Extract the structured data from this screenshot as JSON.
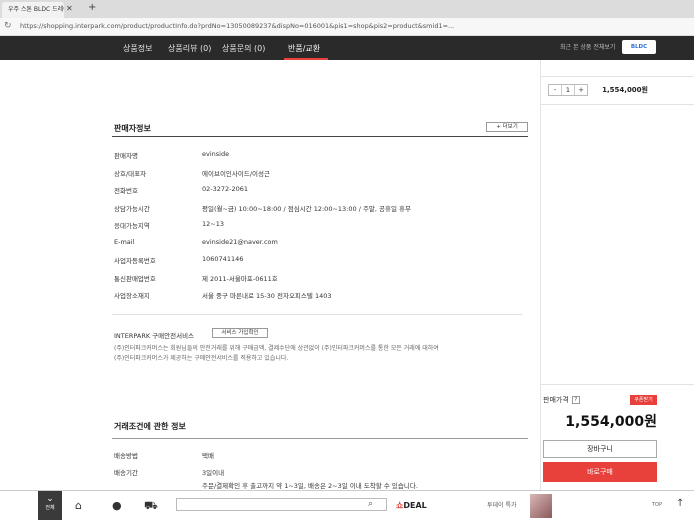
{
  "browser": {
    "tab_title": "우주 스톤 BLDC 드레이어",
    "new_tab": "+",
    "url": "https://shopping.interpark.com/product/productInfo.do?prdNo=13050089237&dispNo=016001&pis1=shop&pis2=product&smid1=..."
  },
  "site_nav": {
    "tabs": [
      {
        "label": "상품정보"
      },
      {
        "label": "상품리뷰 (0)"
      },
      {
        "label": "상품문의 (0)"
      },
      {
        "label": "반품/교환"
      }
    ],
    "right_text": "최근 본 상품 전체보기",
    "right_badge": "BLDC"
  },
  "sidebar": {
    "qty_minus": "-",
    "qty_value": "1",
    "qty_plus": "+",
    "price_top": "1,554,000원",
    "sale_label": "판매가격",
    "help": "?",
    "coupon_badge": "쿠폰받기",
    "price_big": "1,554,000원",
    "cart_button": "장바구니",
    "buy_button": "바로구매"
  },
  "seller_info": {
    "title": "판매자정보",
    "more_button": "+ 더보기",
    "rows": [
      {
        "label": "판매자명",
        "value": "evinside"
      },
      {
        "label": "상호/대표자",
        "value": "에이브이인사이드/이성근"
      },
      {
        "label": "전화번호",
        "value": "02-3272-2061"
      },
      {
        "label": "상담가능시간",
        "value": "평일(월~금) 10:00~18:00 / 점심시간 12:00~13:00 / 주말, 공휴일 휴무"
      },
      {
        "label": "응대가능지역",
        "value": "12~13"
      },
      {
        "label": "E-mail",
        "value": "evinside21@naver.com"
      },
      {
        "label": "사업자등록번호",
        "value": "1060741146"
      },
      {
        "label": "통신판매업번호",
        "value": "제 2011-서울마포-0611호"
      },
      {
        "label": "사업장소재지",
        "value": "서울 중구 마른내로 15-30 전자오피스텔 1403"
      }
    ]
  },
  "notice": {
    "title": "INTERPARK 구매안전서비스",
    "button": "서비스 가입확인",
    "lines": [
      "(주)인터파크커머스는 회원님들의 안전거래를 위해 구매금액, 결제수단에 상관없이 (주)인터파크커머스를 통한 모든 거래에 대하여",
      "(주)인터파크커머스가 제공하는 구매안전서비스를 적용하고 있습니다."
    ]
  },
  "trade_info": {
    "title": "거래조건에 관한 정보",
    "rows": [
      {
        "label": "배송방법",
        "value": "택배"
      },
      {
        "label": "배송기간",
        "value": "3일이내"
      },
      {
        "label": "",
        "value": "주문/결제확인 후 출고까지 약 1~3일, 배송은 2~3일 이내 도착할 수 있습니다."
      }
    ]
  },
  "bottom_bar": {
    "menu_label": "전체",
    "search_placeholder": "",
    "deal_prefix": "쇼",
    "deal_text": "DEAL",
    "promo": "투데이 특가",
    "right_text": "TOP"
  }
}
